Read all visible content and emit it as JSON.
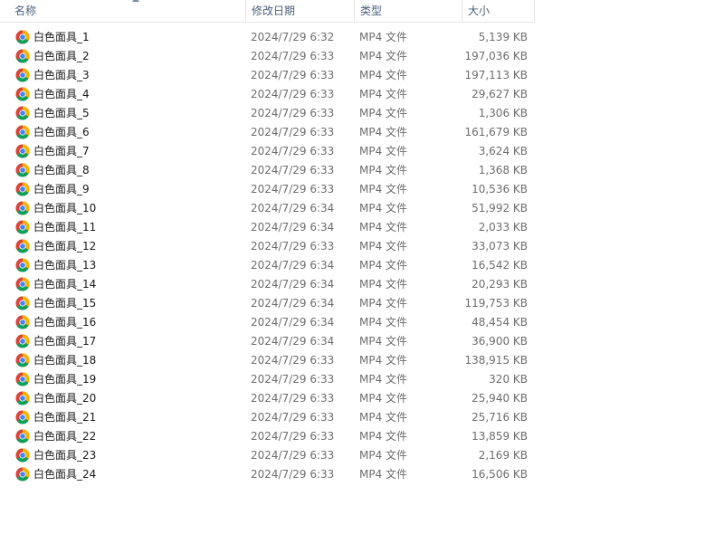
{
  "header": {
    "name": "名称",
    "date": "修改日期",
    "type": "类型",
    "size": "大小"
  },
  "files": [
    {
      "name": "白色面具_1",
      "date": "2024/7/29 6:32",
      "type": "MP4 文件",
      "size": "5,139 KB",
      "icon": "chrome-icon"
    },
    {
      "name": "白色面具_2",
      "date": "2024/7/29 6:33",
      "type": "MP4 文件",
      "size": "197,036 KB",
      "icon": "chrome-icon"
    },
    {
      "name": "白色面具_3",
      "date": "2024/7/29 6:33",
      "type": "MP4 文件",
      "size": "197,113 KB",
      "icon": "chrome-icon"
    },
    {
      "name": "白色面具_4",
      "date": "2024/7/29 6:33",
      "type": "MP4 文件",
      "size": "29,627 KB",
      "icon": "chrome-icon"
    },
    {
      "name": "白色面具_5",
      "date": "2024/7/29 6:33",
      "type": "MP4 文件",
      "size": "1,306 KB",
      "icon": "chrome-icon"
    },
    {
      "name": "白色面具_6",
      "date": "2024/7/29 6:33",
      "type": "MP4 文件",
      "size": "161,679 KB",
      "icon": "chrome-icon"
    },
    {
      "name": "白色面具_7",
      "date": "2024/7/29 6:33",
      "type": "MP4 文件",
      "size": "3,624 KB",
      "icon": "chrome-icon"
    },
    {
      "name": "白色面具_8",
      "date": "2024/7/29 6:33",
      "type": "MP4 文件",
      "size": "1,368 KB",
      "icon": "chrome-icon"
    },
    {
      "name": "白色面具_9",
      "date": "2024/7/29 6:33",
      "type": "MP4 文件",
      "size": "10,536 KB",
      "icon": "chrome-icon"
    },
    {
      "name": "白色面具_10",
      "date": "2024/7/29 6:34",
      "type": "MP4 文件",
      "size": "51,992 KB",
      "icon": "chrome-icon"
    },
    {
      "name": "白色面具_11",
      "date": "2024/7/29 6:34",
      "type": "MP4 文件",
      "size": "2,033 KB",
      "icon": "chrome-icon"
    },
    {
      "name": "白色面具_12",
      "date": "2024/7/29 6:33",
      "type": "MP4 文件",
      "size": "33,073 KB",
      "icon": "chrome-icon"
    },
    {
      "name": "白色面具_13",
      "date": "2024/7/29 6:34",
      "type": "MP4 文件",
      "size": "16,542 KB",
      "icon": "chrome-icon"
    },
    {
      "name": "白色面具_14",
      "date": "2024/7/29 6:34",
      "type": "MP4 文件",
      "size": "20,293 KB",
      "icon": "chrome-icon"
    },
    {
      "name": "白色面具_15",
      "date": "2024/7/29 6:34",
      "type": "MP4 文件",
      "size": "119,753 KB",
      "icon": "chrome-icon"
    },
    {
      "name": "白色面具_16",
      "date": "2024/7/29 6:34",
      "type": "MP4 文件",
      "size": "48,454 KB",
      "icon": "chrome-icon"
    },
    {
      "name": "白色面具_17",
      "date": "2024/7/29 6:34",
      "type": "MP4 文件",
      "size": "36,900 KB",
      "icon": "chrome-icon"
    },
    {
      "name": "白色面具_18",
      "date": "2024/7/29 6:33",
      "type": "MP4 文件",
      "size": "138,915 KB",
      "icon": "chrome-icon"
    },
    {
      "name": "白色面具_19",
      "date": "2024/7/29 6:33",
      "type": "MP4 文件",
      "size": "320 KB",
      "icon": "chrome-icon"
    },
    {
      "name": "白色面具_20",
      "date": "2024/7/29 6:33",
      "type": "MP4 文件",
      "size": "25,940 KB",
      "icon": "chrome-icon"
    },
    {
      "name": "白色面具_21",
      "date": "2024/7/29 6:33",
      "type": "MP4 文件",
      "size": "25,716 KB",
      "icon": "chrome-icon"
    },
    {
      "name": "白色面具_22",
      "date": "2024/7/29 6:33",
      "type": "MP4 文件",
      "size": "13,859 KB",
      "icon": "chrome-icon"
    },
    {
      "name": "白色面具_23",
      "date": "2024/7/29 6:33",
      "type": "MP4 文件",
      "size": "2,169 KB",
      "icon": "chrome-icon"
    },
    {
      "name": "白色面具_24",
      "date": "2024/7/29 6:33",
      "type": "MP4 文件",
      "size": "16,506 KB",
      "icon": "chrome-icon"
    }
  ],
  "colors": {
    "header_text": "#4c607a",
    "name_text": "#1a1a1a",
    "meta_text": "#6d6d6d",
    "divider": "#e5e5e5"
  }
}
